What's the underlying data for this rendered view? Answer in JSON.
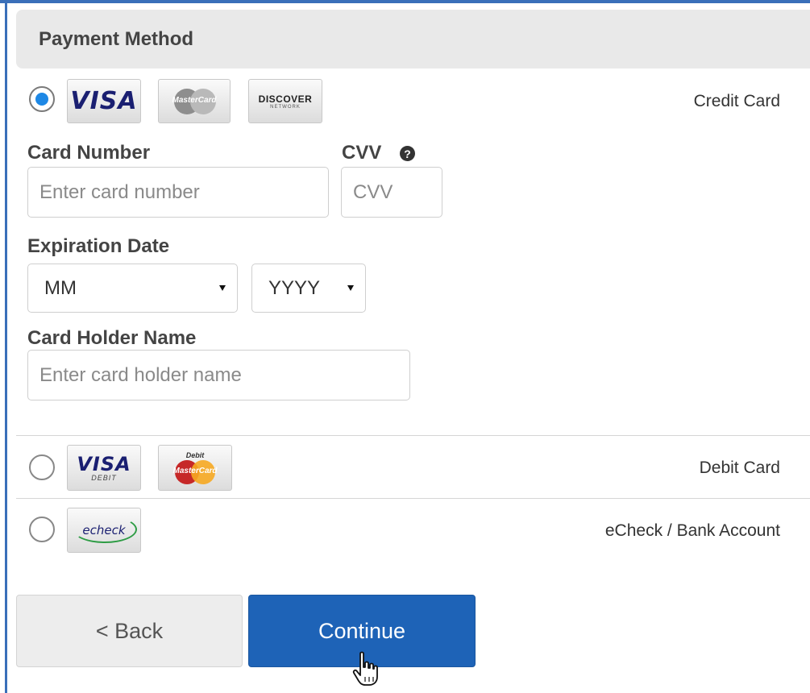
{
  "header": {
    "title": "Payment Method"
  },
  "credit_card": {
    "label": "Credit Card",
    "selected": true,
    "logos": {
      "visa": "VISA",
      "mastercard": "MasterCard",
      "discover": "DISCOVER",
      "discover_sub": "NETWORK"
    }
  },
  "form": {
    "card_number_label": "Card Number",
    "card_number_placeholder": "Enter card number",
    "cvv_label": "CVV",
    "cvv_placeholder": "CVV",
    "cvv_help_icon": "?",
    "expiration_label": "Expiration Date",
    "month_value": "MM",
    "year_value": "YYYY",
    "holder_label": "Card Holder Name",
    "holder_placeholder": "Enter card holder name"
  },
  "debit_card": {
    "label": "Debit Card",
    "selected": false,
    "logos": {
      "visa": "VISA",
      "visa_sub": "DEBIT",
      "mastercard_top": "Debit",
      "mastercard": "MasterCard"
    }
  },
  "echeck": {
    "label": "eCheck / Bank Account",
    "selected": false,
    "logo": "echeck"
  },
  "buttons": {
    "back": "< Back",
    "continue": "Continue"
  },
  "colors": {
    "accent": "#1e63b7",
    "radio_selected": "#1e88e5",
    "frame": "#3a6fb9"
  }
}
